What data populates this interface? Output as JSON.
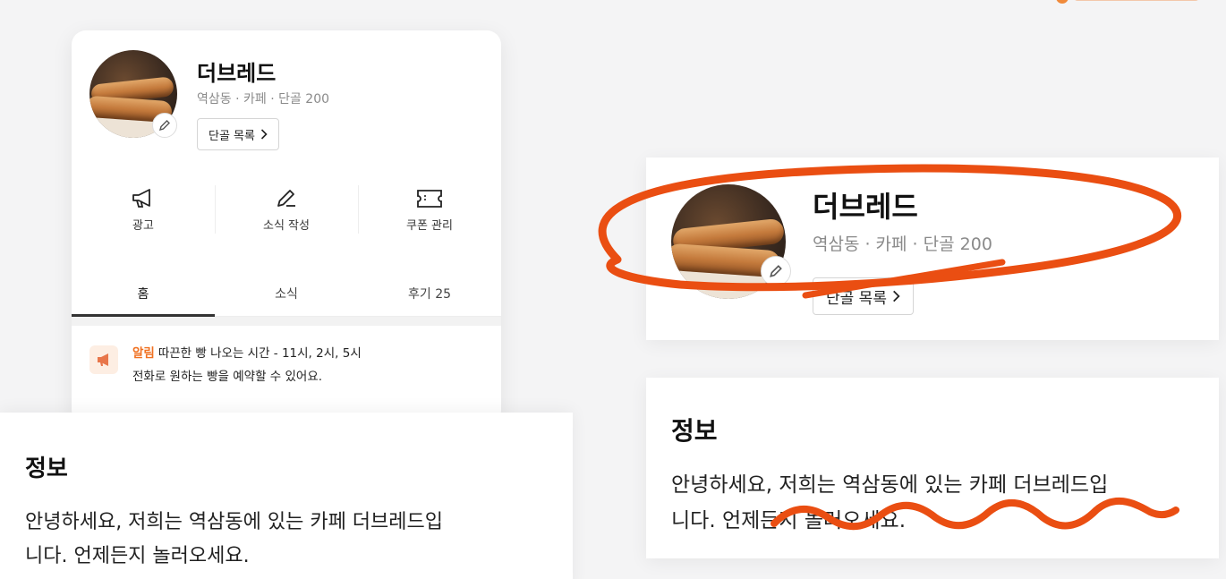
{
  "store": {
    "name": "더브레드",
    "meta": "역삼동 · 카페 · 단골 200",
    "regulars_button": "단골 목록"
  },
  "actions": [
    {
      "label": "광고",
      "icon": "megaphone-icon"
    },
    {
      "label": "소식 작성",
      "icon": "pencil-icon"
    },
    {
      "label": "쿠폰 관리",
      "icon": "ticket-icon"
    }
  ],
  "tabs": [
    {
      "label": "홈",
      "active": true
    },
    {
      "label": "소식",
      "active": false
    },
    {
      "label": "후기 25",
      "active": false
    }
  ],
  "notice": {
    "tag": "알림",
    "line1": "따끈한 빵 나오는 시간 - 11시, 2시, 5시",
    "line2": "전화로 원하는 빵을 예약할 수 있어요."
  },
  "info": {
    "title": "정보",
    "body_line1": "안녕하세요, 저희는 역삼동에 있는 카페 더브레드입",
    "body_line2": "니다. 언제든지 놀러오세요."
  },
  "colors": {
    "accent": "#f07020",
    "annotation": "#ea4e12"
  }
}
